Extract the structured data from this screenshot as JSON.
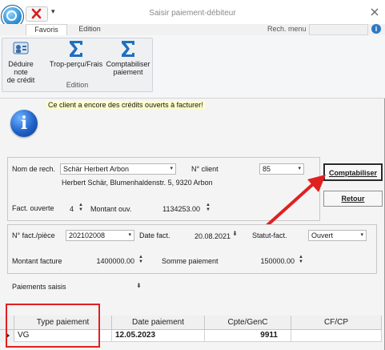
{
  "window": {
    "title": "Saisir paiement-débiteur",
    "quick_access_more": "▾"
  },
  "ribbon": {
    "tabs": [
      {
        "label": "Favoris"
      },
      {
        "label": "Edition"
      }
    ],
    "search_label": "Rech. menu",
    "search_value": "",
    "group_label": "Edition",
    "buttons": [
      {
        "label_line1": "Déduire note",
        "label_line2": "de crédit"
      },
      {
        "label_line1": "Trop-perçu/Frais",
        "label_line2": ""
      },
      {
        "label_line1": "Comptabiliser",
        "label_line2": "paiement"
      }
    ]
  },
  "notice": "Ce client a encore des crédits ouverts à facturer!",
  "client": {
    "search_label": "Nom de rech.",
    "search_value": "Schär Herbert Arbon",
    "client_no_label": "N° client",
    "client_no_value": "85",
    "address": "Herbert Schär, Blumenhaldenstr. 5, 9320 Arbon",
    "open_invoices_label": "Fact. ouverte",
    "open_invoices_value": "4",
    "open_amount_label": "Montant ouv.",
    "open_amount_value": "1134253.00"
  },
  "invoice": {
    "no_label": "N° fact./pièce",
    "no_value": "202102008",
    "date_label": "Date fact.",
    "date_value": "20.08.2021",
    "status_label": "Statut-fact.",
    "status_value": "Ouvert",
    "amount_label": "Montant facture",
    "amount_value": "1400000.00",
    "payment_sum_label": "Somme paiement",
    "payment_sum_value": "150000.00"
  },
  "actions": {
    "comptabiliser_label": "Comptabiliser",
    "retour_label": "Retour"
  },
  "payments_label": "Paiements saisis",
  "grid": {
    "columns": [
      "Type paiement",
      "Date paiement",
      "Cpte/GenC",
      "CF/CP"
    ],
    "rows": [
      {
        "type": "VG",
        "date": "12.05.2023",
        "account": "9911",
        "cfcp": ""
      }
    ]
  },
  "colors": {
    "annotation": "#e02020",
    "accent": "#1f63c9",
    "notice_bg": "#ffffcc"
  }
}
